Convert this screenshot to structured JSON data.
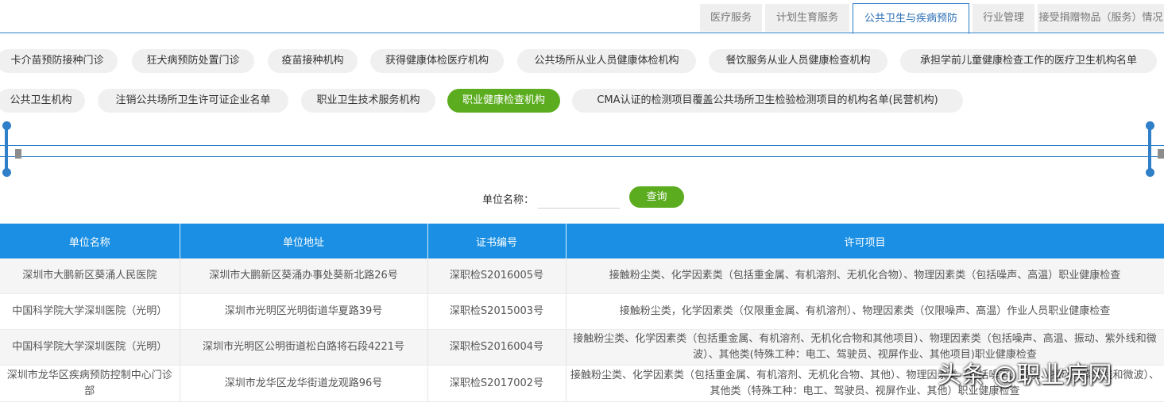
{
  "top_tabs": [
    "医疗服务",
    "计划生育服务",
    "公共卫生与疾病预防",
    "行业管理",
    "接受捐赠物品（服务）情况"
  ],
  "active_top_tab": "公共卫生与疾病预防",
  "categories_row1": [
    "卡介苗预防接种门诊",
    "狂犬病预防处置门诊",
    "疫苗接种机构",
    "获得健康体检医疗机构",
    "公共场所从业人员健康体检机构",
    "餐饮服务从业人员健康检查机构",
    "承担学前儿童健康检查工作的医疗卫生机构名单"
  ],
  "categories_row2": [
    "公共卫生机构",
    "注销公共场所卫生许可证企业名单",
    "职业卫生技术服务机构",
    "职业健康检查机构",
    "CMA认证的检测项目覆盖公共场所卫生检验检测项目的机构名单(民营机构)"
  ],
  "active_category": "职业健康检查机构",
  "search": {
    "label": "单位名称：",
    "value": "",
    "button": "查询"
  },
  "table": {
    "headers": [
      "单位名称",
      "单位地址",
      "证书编号",
      "许可项目"
    ],
    "rows": [
      [
        "深圳市大鹏新区葵涌人民医院",
        "深圳市大鹏新区葵涌办事处葵新北路26号",
        "深职检S2016005号",
        "接触粉尘类、化学因素类（包括重金属、有机溶剂、无机化合物）、物理因素类（包括噪声、高温）职业健康检查"
      ],
      [
        "中国科学院大学深圳医院（光明）",
        "深圳市光明区光明街道华夏路39号",
        "深职检S2015003号",
        "接触粉尘类，化学因素类（仅限重金属、有机溶剂）、物理因素类（仅限噪声、高温）作业人员职业健康检查"
      ],
      [
        "中国科学院大学深圳医院（光明）",
        "深圳市光明区公明街道松白路将石段4221号",
        "深职检S2016004号",
        "接触粉尘类、化学因素类（包括重金属、有机溶剂、无机化合物和其他项目）、物理因素类（包括噪声、高温、振动、紫外线和微波）、其他类(特殊工种：电工、驾驶员、视屏作业、其他项目)职业健康检查"
      ],
      [
        "深圳市龙华区疾病预防控制中心门诊部",
        "深圳市龙华区龙华街道龙观路96号",
        "深职检S2017002号",
        "接触粉尘类、化学因素类（包括重金属、有机溶剂、无机化合物、其他）、物理因素类（包括噪声、高温、振动、紫外线和微波）、其他类（特殊工种：电工、驾驶员、视屏作业、其他）职业健康检查"
      ]
    ]
  },
  "watermark": "头条 @职业病网",
  "colors": {
    "accent": "#2f7fc9",
    "green": "#5bac1f",
    "header_bg": "#1a8fe3"
  }
}
